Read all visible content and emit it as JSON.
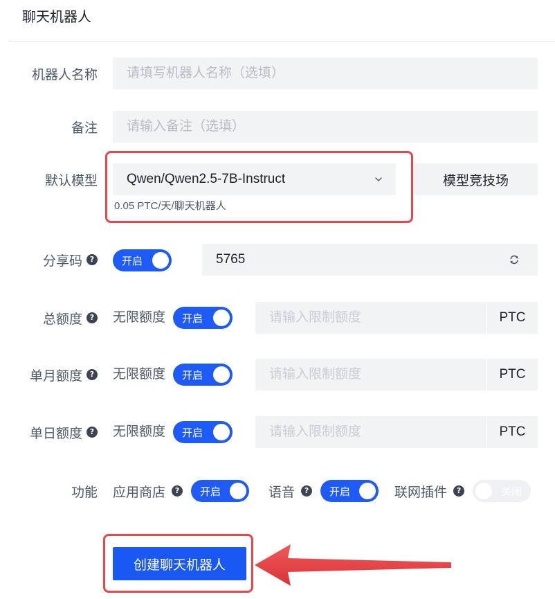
{
  "header": {
    "title": "聊天机器人"
  },
  "form": {
    "bot_name": {
      "label": "机器人名称",
      "placeholder": "请填写机器人名称（选填）"
    },
    "remark": {
      "label": "备注",
      "placeholder": "请输入备注（选填）"
    },
    "model": {
      "label": "默认模型",
      "selected": "Qwen/Qwen2.5-7B-Instruct",
      "price_note": "0.05 PTC/天/聊天机器人",
      "arena_button": "模型竞技场"
    },
    "share_code": {
      "label": "分享码",
      "toggle_text": "开启",
      "toggle_on": true,
      "value": "5765"
    },
    "total_quota": {
      "label": "总额度",
      "unlimited_label": "无限额度",
      "toggle_text": "开启",
      "toggle_on": true,
      "placeholder": "请输入限制额度",
      "unit": "PTC"
    },
    "monthly_quota": {
      "label": "单月额度",
      "unlimited_label": "无限额度",
      "toggle_text": "开启",
      "toggle_on": true,
      "placeholder": "请输入限制额度",
      "unit": "PTC"
    },
    "daily_quota": {
      "label": "单日额度",
      "unlimited_label": "无限额度",
      "toggle_text": "开启",
      "toggle_on": true,
      "placeholder": "请输入限制额度",
      "unit": "PTC"
    },
    "features": {
      "label": "功能",
      "items": [
        {
          "label": "应用商店",
          "toggle_text": "开启",
          "toggle_on": true
        },
        {
          "label": "语音",
          "toggle_text": "开启",
          "toggle_on": true
        },
        {
          "label": "联网插件",
          "toggle_text": "关闭",
          "toggle_on": false
        }
      ]
    }
  },
  "submit_button": "创建聊天机器人",
  "icons": {
    "help": "help-icon",
    "model_select": "chevron-down-icon",
    "share_code_refresh": "refresh-icon",
    "annotation": "arrow-left-icon"
  },
  "colors": {
    "primary": "#1e5bf6",
    "highlight": "#e8474a",
    "field_background": "#f2f3f5",
    "label": "#4e5969"
  }
}
